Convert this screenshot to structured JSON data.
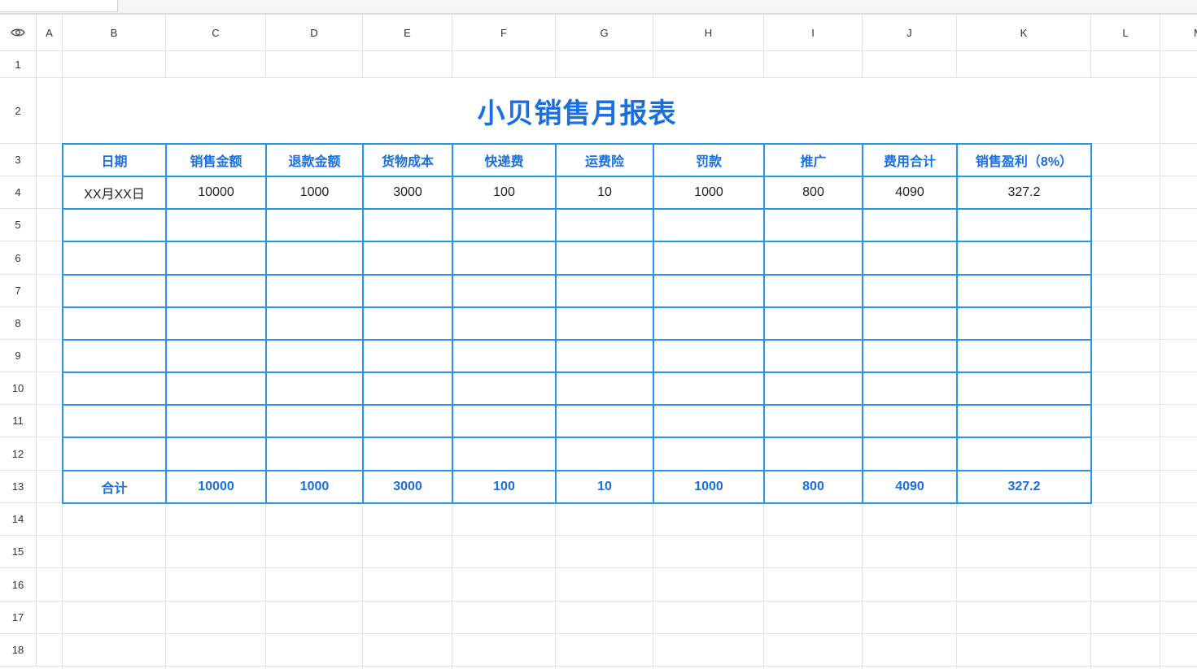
{
  "columns": [
    "A",
    "B",
    "C",
    "D",
    "E",
    "F",
    "G",
    "H",
    "I",
    "J",
    "K",
    "L",
    "M"
  ],
  "rows": [
    "1",
    "2",
    "3",
    "4",
    "5",
    "6",
    "7",
    "8",
    "9",
    "10",
    "11",
    "12",
    "13",
    "14",
    "15",
    "16",
    "17",
    "18"
  ],
  "report": {
    "title": "小贝销售月报表",
    "headers": [
      "日期",
      "销售金额",
      "退款金额",
      "货物成本",
      "快递费",
      "运费险",
      "罚款",
      "推广",
      "费用合计",
      "销售盈利（8%）"
    ],
    "data_row": [
      "XX月XX日",
      "10000",
      "1000",
      "3000",
      "100",
      "10",
      "1000",
      "800",
      "4090",
      "327.2"
    ],
    "total_row": [
      "合计",
      "10000",
      "1000",
      "3000",
      "100",
      "10",
      "1000",
      "800",
      "4090",
      "327.2"
    ]
  },
  "colors": {
    "accent": "#1a6fe0",
    "border": "#2a95e6"
  },
  "icons": {
    "corner": "eye-icon"
  }
}
